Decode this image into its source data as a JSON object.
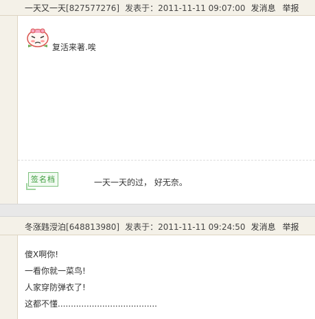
{
  "post1": {
    "author": "一天又一天",
    "uid": "[827577276]",
    "posted_label": "发表于：",
    "datetime": "2011-11-11 09:07:00",
    "message_link": "发消息",
    "report_link": "举报",
    "content": "复活来著.唉",
    "signature_badge": "签名档",
    "signature_text": "一天一天的过， 好无奈。"
  },
  "post2": {
    "author": "冬涨韪涭泊",
    "uid": "[648813980]",
    "posted_label": "发表于：",
    "datetime": "2011-11-11 09:24:50",
    "message_link": "发消息",
    "report_link": "举报",
    "lines": [
      "傻X啊你!",
      "一看你就一菜鸟!",
      "人家穿防弹衣了!",
      "这都不懂......................................"
    ]
  },
  "icons": {
    "post1_emoji": "smiley-face-icon",
    "signature": "signature-badge-icon"
  },
  "colors": {
    "header_bg": "#f4f1e8",
    "border": "#ddd4c1",
    "divider_band": "#e8e8e8",
    "signature_green": "#3a9a3a"
  }
}
